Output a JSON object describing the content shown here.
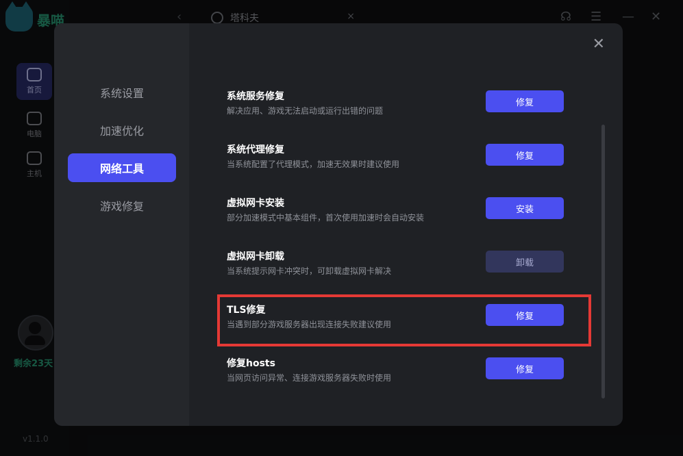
{
  "app": {
    "logo_text": "暴喵",
    "nav": [
      {
        "label": "首页",
        "icon": "home-icon"
      },
      {
        "label": "电脑",
        "icon": "monitor-icon"
      },
      {
        "label": "主机",
        "icon": "gamepad-icon"
      }
    ],
    "days_remaining": "剩余23天",
    "version": "v1.1.0",
    "search_value": "塔科夫"
  },
  "modal": {
    "sidebar": [
      "系统设置",
      "加速优化",
      "网络工具",
      "游戏修复"
    ],
    "active_index": 2,
    "rows": [
      {
        "title": "系统服务修复",
        "desc": "解决应用、游戏无法启动或运行出错的问题",
        "button": "修复",
        "disabled": false
      },
      {
        "title": "系统代理修复",
        "desc": "当系统配置了代理模式，加速无效果时建议使用",
        "button": "修复",
        "disabled": false
      },
      {
        "title": "虚拟网卡安装",
        "desc": "部分加速模式中基本组件，首次使用加速时会自动安装",
        "button": "安装",
        "disabled": false
      },
      {
        "title": "虚拟网卡卸载",
        "desc": "当系统提示网卡冲突时，可卸载虚拟网卡解决",
        "button": "卸载",
        "disabled": true
      },
      {
        "title": "TLS修复",
        "desc": "当遇到部分游戏服务器出现连接失败建议使用",
        "button": "修复",
        "disabled": false
      },
      {
        "title": "修复hosts",
        "desc": "当网页访问异常、连接游戏服务器失败时使用",
        "button": "修复",
        "disabled": false
      }
    ],
    "close_icon": "close-icon",
    "highlight_color": "#e53935",
    "accent": "#4b4ff0"
  }
}
